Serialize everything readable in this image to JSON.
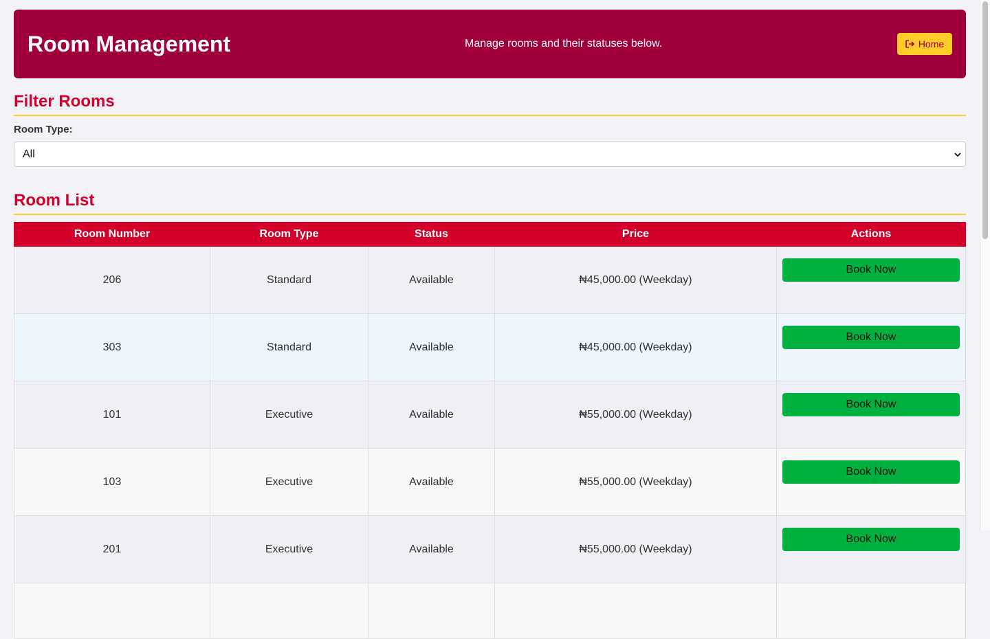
{
  "header": {
    "title": "Room Management",
    "subtitle": "Manage rooms and their statuses below.",
    "home_label": "Home"
  },
  "filter": {
    "title": "Filter Rooms",
    "room_type_label": "Room Type:",
    "selected_value": "All"
  },
  "room_list": {
    "title": "Room List",
    "columns": [
      "Room Number",
      "Room Type",
      "Status",
      "Price",
      "Actions"
    ],
    "rows": [
      {
        "number": "206",
        "type": "Standard",
        "status": "Available",
        "price": "₦45,000.00 (Weekday)",
        "action": "Book Now"
      },
      {
        "number": "303",
        "type": "Standard",
        "status": "Available",
        "price": "₦45,000.00 (Weekday)",
        "action": "Book Now"
      },
      {
        "number": "101",
        "type": "Executive",
        "status": "Available",
        "price": "₦55,000.00 (Weekday)",
        "action": "Book Now"
      },
      {
        "number": "103",
        "type": "Executive",
        "status": "Available",
        "price": "₦55,000.00 (Weekday)",
        "action": "Book Now"
      },
      {
        "number": "201",
        "type": "Executive",
        "status": "Available",
        "price": "₦55,000.00 (Weekday)",
        "action": "Book Now"
      },
      {
        "number": "",
        "type": "",
        "status": "",
        "price": "",
        "action": ""
      }
    ]
  },
  "colors": {
    "header_bg": "#a0003a",
    "accent_red": "#d4002a",
    "accent_yellow": "#ffcc29",
    "book_green": "#00b140"
  },
  "icons": {
    "home": "sign-out-icon",
    "select": "chevron-down-icon"
  }
}
